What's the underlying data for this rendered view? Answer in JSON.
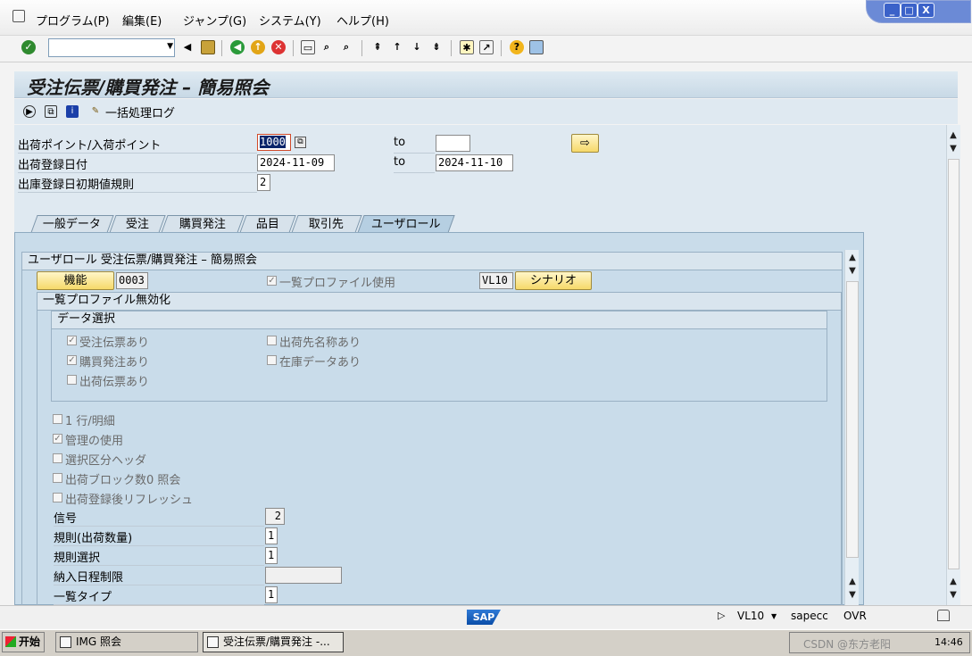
{
  "menu": {
    "items": [
      "プログラム(P)",
      "編集(E)",
      "ジャンプ(G)",
      "システム(Y)",
      "ヘルプ(H)"
    ]
  },
  "window_controls": {
    "min": "_",
    "restore": "□",
    "close": "X"
  },
  "toolbar": {
    "command_value": ""
  },
  "title": "受注伝票/購買発注 – 簡易照会",
  "app_toolbar": {
    "batch_log_label": "一括処理ログ"
  },
  "selection": {
    "shipping_point_label": "出荷ポイント/入荷ポイント",
    "shipping_point_from": "1000",
    "shipping_point_to": "",
    "to_label": "to",
    "creation_date_label": "出荷登録日付",
    "creation_date_from": "2024-11-09",
    "creation_date_to": "2024-11-10",
    "default_rule_label": "出庫登録日初期値規則",
    "default_rule_value": "2"
  },
  "tabs": [
    "一般データ",
    "受注",
    "購買発注",
    "品目",
    "取引先",
    "ユーザロール"
  ],
  "active_tab": 5,
  "user_role": {
    "group_title": "ユーザロール 受注伝票/購買発注 – 簡易照会",
    "function_button": "機能",
    "function_code": "0003",
    "use_list_profile_label": "一覧プロファイル使用",
    "list_profile_value": "VL10",
    "scenario_button": "シナリオ",
    "disable_profile_title": "一覧プロファイル無効化",
    "data_selection_title": "データ選択",
    "checks": {
      "sales_order": "受注伝票あり",
      "ship_to_name": "出荷先名称あり",
      "purchase_order": "購買発注あり",
      "stock_data": "在庫データあり",
      "delivery": "出荷伝票あり"
    },
    "options": {
      "one_line": "1 行/明細",
      "mgmt_use": "管理の使用",
      "sel_header": "選択区分ヘッダ",
      "block_zero": "出荷ブロック数0 照会",
      "refresh_after": "出荷登録後リフレッシュ"
    },
    "signal_label": "信号",
    "signal_value": "2",
    "rule_qty_label": "規則(出荷数量)",
    "rule_qty_value": "1",
    "rule_sel_label": "規則選択",
    "rule_sel_value": "1",
    "delivery_limit_label": "納入日程制限",
    "delivery_limit_value": "",
    "list_type_label": "一覧タイプ",
    "list_type_value": "1"
  },
  "status": {
    "transaction": "VL10",
    "server": "sapecc",
    "mode": "OVR",
    "logo": "SAP"
  },
  "taskbar": {
    "start": "开始",
    "task1": "IMG 照会",
    "task2": "受注伝票/購買発注 -...",
    "clock": "14:46",
    "watermark": "CSDN @东方老阳"
  }
}
